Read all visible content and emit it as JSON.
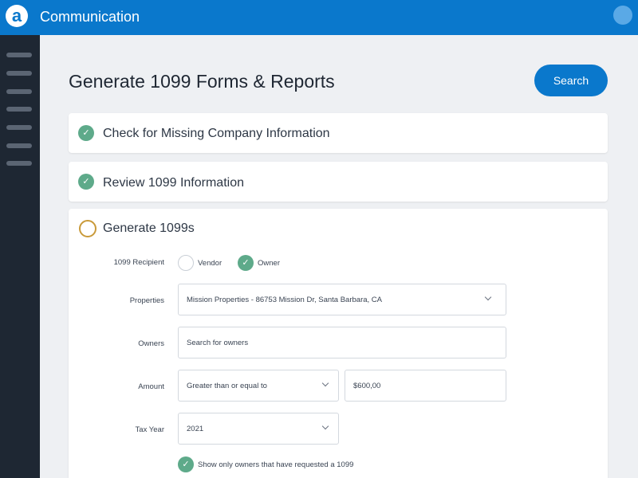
{
  "header": {
    "logo_letter": "a",
    "app_title": "Communication"
  },
  "page": {
    "title": "Generate 1099 Forms & Reports",
    "search_label": "Search"
  },
  "steps": [
    {
      "label": "Check for Missing Company Information",
      "status": "complete"
    },
    {
      "label": "Review 1099 Information",
      "status": "complete"
    },
    {
      "label": "Generate 1099s",
      "status": "in-progress"
    }
  ],
  "form": {
    "recipient": {
      "label": "1099 Recipient",
      "options": [
        "Vendor",
        "Owner"
      ],
      "selected": "Owner"
    },
    "properties": {
      "label": "Properties",
      "value": "Mission Properties - 86753 Mission Dr, Santa Barbara, CA"
    },
    "owners": {
      "label": "Owners",
      "placeholder": "Search for owners"
    },
    "amount": {
      "label": "Amount",
      "operator": "Greater than or equal to",
      "value": "$600,00"
    },
    "tax_year": {
      "label": "Tax Year",
      "value": "2021"
    },
    "only_requested": {
      "label": "Show only owners that have requested a 1099",
      "checked": true
    }
  },
  "colors": {
    "brand": "#0a78cc",
    "sidebar": "#1e2733",
    "success": "#5eaa8a",
    "progress": "#c99a3a"
  }
}
